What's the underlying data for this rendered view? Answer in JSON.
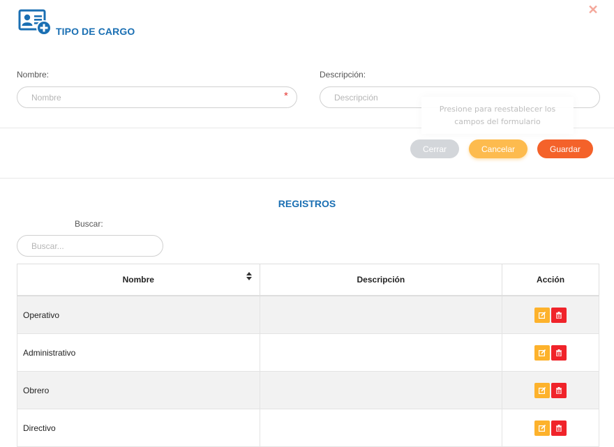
{
  "modal": {
    "title": "TIPO DE CARGO",
    "close_icon": "close-icon",
    "header_icon": "user-card-add-icon"
  },
  "form": {
    "nombre_label": "Nombre:",
    "nombre_placeholder": "Nombre",
    "nombre_value": "",
    "nombre_required_mark": "*",
    "descripcion_label": "Descripción:",
    "descripcion_placeholder": "Descripción",
    "descripcion_value": ""
  },
  "tooltip": {
    "line1": "Presione para reestablecer los",
    "line2": "campos del formulario"
  },
  "buttons": {
    "cerrar": "Cerrar",
    "cancelar": "Cancelar",
    "guardar": "Guardar"
  },
  "colors": {
    "accent": "#1a6fb3",
    "guardar": "#f4622a",
    "cancelar": "#fdbb4e",
    "cerrar": "#d3d6da",
    "edit": "#fdb22c",
    "delete": "#f0232a"
  },
  "registros": {
    "title": "REGISTROS",
    "search_label": "Buscar:",
    "search_placeholder": "Buscar...",
    "columns": [
      "Nombre",
      "Descripción",
      "Acción"
    ],
    "rows": [
      {
        "nombre": "Operativo",
        "descripcion": ""
      },
      {
        "nombre": "Administrativo",
        "descripcion": ""
      },
      {
        "nombre": "Obrero",
        "descripcion": ""
      },
      {
        "nombre": "Directivo",
        "descripcion": ""
      }
    ]
  }
}
